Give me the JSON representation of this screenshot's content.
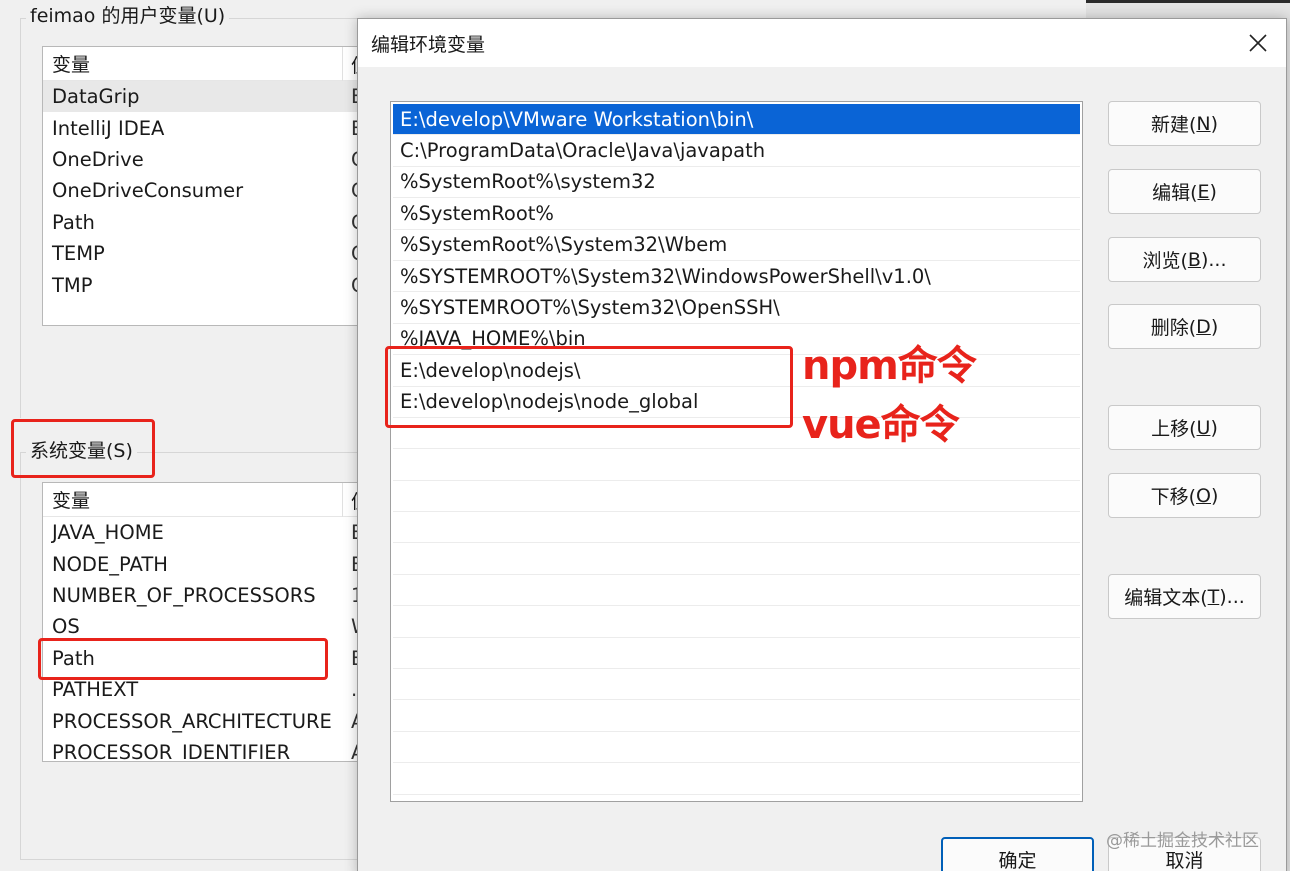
{
  "user_vars": {
    "title": "feimao 的用户变量(U)",
    "col_var": "变量",
    "col_val": "值",
    "rows": [
      {
        "name": "DataGrip",
        "v": "E"
      },
      {
        "name": "IntelliJ IDEA",
        "v": "E"
      },
      {
        "name": "OneDrive",
        "v": "C"
      },
      {
        "name": "OneDriveConsumer",
        "v": "C"
      },
      {
        "name": "Path",
        "v": "C"
      },
      {
        "name": "TEMP",
        "v": "C"
      },
      {
        "name": "TMP",
        "v": "C"
      }
    ]
  },
  "system_vars": {
    "title": "系统变量(S)",
    "col_var": "变量",
    "col_val": "值",
    "rows": [
      {
        "name": "JAVA_HOME",
        "v": "E"
      },
      {
        "name": "NODE_PATH",
        "v": "E"
      },
      {
        "name": "NUMBER_OF_PROCESSORS",
        "v": "1"
      },
      {
        "name": "OS",
        "v": "W"
      },
      {
        "name": "Path",
        "v": "E"
      },
      {
        "name": "PATHEXT",
        "v": ".C"
      },
      {
        "name": "PROCESSOR_ARCHITECTURE",
        "v": "A"
      },
      {
        "name": "PROCESSOR_IDENTIFIER",
        "v": "A"
      }
    ]
  },
  "dialog": {
    "title": "编辑环境变量",
    "close_glyph": "✕",
    "paths": [
      "E:\\develop\\VMware Workstation\\bin\\",
      "C:\\ProgramData\\Oracle\\Java\\javapath",
      "%SystemRoot%\\system32",
      "%SystemRoot%",
      "%SystemRoot%\\System32\\Wbem",
      "%SYSTEMROOT%\\System32\\WindowsPowerShell\\v1.0\\",
      "%SYSTEMROOT%\\System32\\OpenSSH\\",
      "%JAVA_HOME%\\bin",
      "E:\\develop\\nodejs\\",
      "E:\\develop\\nodejs\\node_global"
    ],
    "buttons": {
      "new": {
        "text": "新建(",
        "key": "N",
        "end": ")"
      },
      "edit": {
        "text": "编辑(",
        "key": "E",
        "end": ")"
      },
      "browse": {
        "text": "浏览(",
        "key": "B",
        "end": ")..."
      },
      "delete": {
        "text": "删除(",
        "key": "D",
        "end": ")"
      },
      "up": {
        "text": "上移(",
        "key": "U",
        "end": ")"
      },
      "down": {
        "text": "下移(",
        "key": "O",
        "end": ")"
      },
      "edittext": {
        "text": "编辑文本(",
        "key": "T",
        "end": ")..."
      },
      "ok": "确定",
      "cancel": "取消"
    }
  },
  "annotations": {
    "npm": "npm命令",
    "vue": "vue命令",
    "color": "#e8231b"
  },
  "watermark": "@稀土掘金技术社区",
  "colors": {
    "selection": "#0a64d6",
    "background": "#f0f0f0"
  }
}
